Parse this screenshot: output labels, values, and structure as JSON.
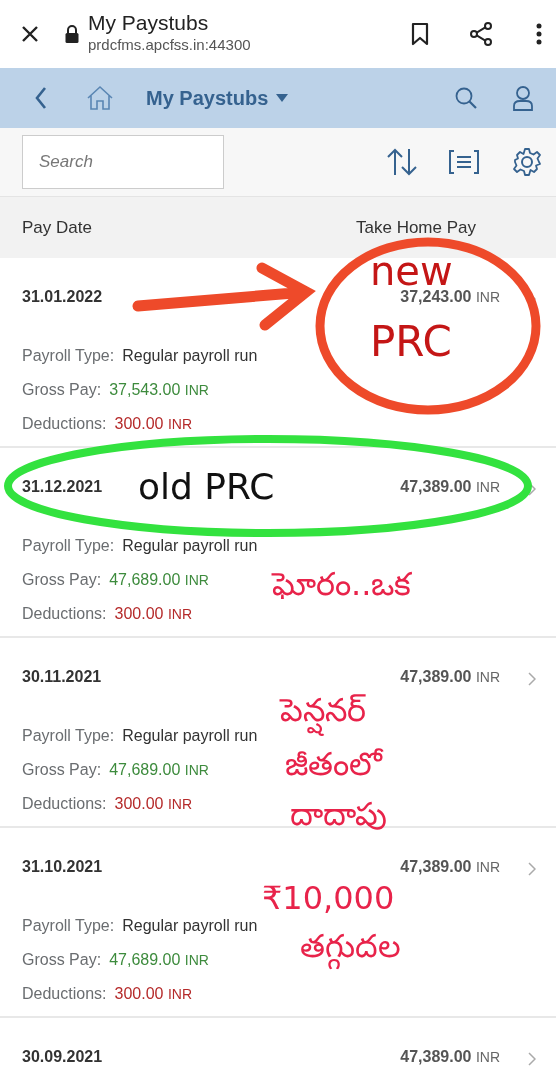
{
  "browser": {
    "page_title": "My Paystubs",
    "url": "prdcfms.apcfss.in:44300"
  },
  "app_bar": {
    "title": "My Paystubs"
  },
  "toolbar": {
    "search": {
      "placeholder": "Search"
    }
  },
  "table": {
    "columns": [
      "Pay Date",
      "Take Home Pay"
    ],
    "rows": [
      {
        "date": "31.01.2022",
        "amount": "37,243.00",
        "currency": "INR",
        "details": [
          {
            "kind": "text",
            "label": "Payroll Type:",
            "value": "Regular payroll run"
          },
          {
            "kind": "gain",
            "label": "Gross Pay:",
            "value": "37,543.00",
            "currency": "INR"
          },
          {
            "kind": "loss",
            "label": "Deductions:",
            "value": "300.00",
            "currency": "INR"
          }
        ]
      },
      {
        "date": "31.12.2021",
        "amount": "47,389.00",
        "currency": "INR",
        "details": [
          {
            "kind": "text",
            "label": "Payroll Type:",
            "value": "Regular payroll run"
          },
          {
            "kind": "gain",
            "label": "Gross Pay:",
            "value": "47,689.00",
            "currency": "INR"
          },
          {
            "kind": "loss",
            "label": "Deductions:",
            "value": "300.00",
            "currency": "INR"
          }
        ]
      },
      {
        "date": "30.11.2021",
        "amount": "47,389.00",
        "currency": "INR",
        "details": [
          {
            "kind": "text",
            "label": "Payroll Type:",
            "value": "Regular payroll run"
          },
          {
            "kind": "gain",
            "label": "Gross Pay:",
            "value": "47,689.00",
            "currency": "INR"
          },
          {
            "kind": "loss",
            "label": "Deductions:",
            "value": "300.00",
            "currency": "INR"
          }
        ]
      },
      {
        "date": "31.10.2021",
        "amount": "47,389.00",
        "currency": "INR",
        "details": [
          {
            "kind": "text",
            "label": "Payroll Type:",
            "value": "Regular payroll run"
          },
          {
            "kind": "gain",
            "label": "Gross Pay:",
            "value": "47,689.00",
            "currency": "INR"
          },
          {
            "kind": "loss",
            "label": "Deductions:",
            "value": "300.00",
            "currency": "INR"
          }
        ]
      },
      {
        "date": "30.09.2021",
        "amount": "47,389.00",
        "currency": "INR",
        "details": []
      }
    ]
  },
  "annotations": [
    {
      "kind": "arrow",
      "color": "#ee4a2a"
    },
    {
      "kind": "circle",
      "color": "#ee4a2a",
      "lines": [
        "new",
        "PRC"
      ]
    },
    {
      "kind": "ellipse",
      "color": "#33e23f",
      "lines": [
        "old PRC"
      ]
    },
    {
      "kind": "note",
      "lines": [
        "ఘోరం..ఒక",
        "పెన్షనర్",
        "జీతంలో",
        "దాదాపు",
        "₹10,000",
        "తగ్గుదల"
      ]
    }
  ]
}
